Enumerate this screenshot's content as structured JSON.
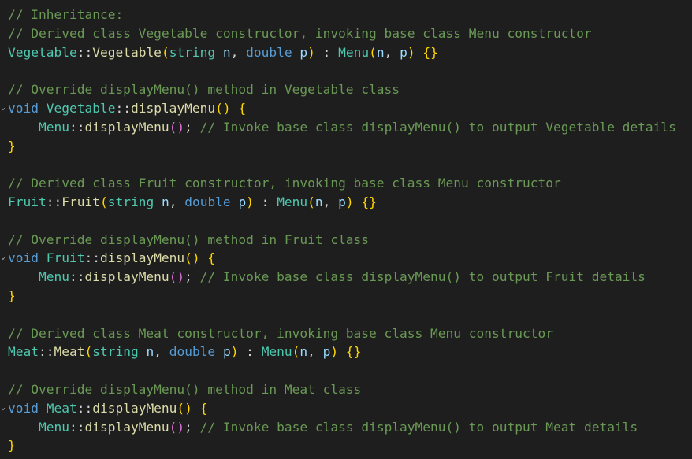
{
  "code": {
    "lines": [
      {
        "tokens": [
          {
            "t": "// Inheritance:",
            "c": "comment"
          }
        ]
      },
      {
        "tokens": [
          {
            "t": "// Derived class Vegetable constructor, invoking base class Menu constructor",
            "c": "comment"
          }
        ]
      },
      {
        "tokens": [
          {
            "t": "Vegetable",
            "c": "type"
          },
          {
            "t": "::",
            "c": "punct"
          },
          {
            "t": "Vegetable",
            "c": "func"
          },
          {
            "t": "(",
            "c": "br1"
          },
          {
            "t": "string",
            "c": "type"
          },
          {
            "t": " ",
            "c": "punct"
          },
          {
            "t": "n",
            "c": "param"
          },
          {
            "t": ", ",
            "c": "punct"
          },
          {
            "t": "double",
            "c": "kw"
          },
          {
            "t": " ",
            "c": "punct"
          },
          {
            "t": "p",
            "c": "param"
          },
          {
            "t": ")",
            "c": "br1"
          },
          {
            "t": " : ",
            "c": "punct"
          },
          {
            "t": "Menu",
            "c": "type"
          },
          {
            "t": "(",
            "c": "br1"
          },
          {
            "t": "n",
            "c": "param"
          },
          {
            "t": ", ",
            "c": "punct"
          },
          {
            "t": "p",
            "c": "param"
          },
          {
            "t": ")",
            "c": "br1"
          },
          {
            "t": " ",
            "c": "punct"
          },
          {
            "t": "{}",
            "c": "br1"
          }
        ]
      },
      {
        "tokens": []
      },
      {
        "tokens": [
          {
            "t": "// Override displayMenu() method in Vegetable class",
            "c": "comment"
          }
        ]
      },
      {
        "fold": true,
        "tokens": [
          {
            "t": "void",
            "c": "kw"
          },
          {
            "t": " ",
            "c": "punct"
          },
          {
            "t": "Vegetable",
            "c": "type"
          },
          {
            "t": "::",
            "c": "punct"
          },
          {
            "t": "displayMenu",
            "c": "func"
          },
          {
            "t": "()",
            "c": "br1"
          },
          {
            "t": " ",
            "c": "punct"
          },
          {
            "t": "{",
            "c": "br1"
          }
        ]
      },
      {
        "tokens": [
          {
            "t": "    ",
            "c": "punct"
          },
          {
            "t": "Menu",
            "c": "type"
          },
          {
            "t": "::",
            "c": "punct"
          },
          {
            "t": "displayMenu",
            "c": "func"
          },
          {
            "t": "()",
            "c": "br2"
          },
          {
            "t": "; ",
            "c": "punct"
          },
          {
            "t": "// Invoke base class displayMenu() to output Vegetable details",
            "c": "comment"
          }
        ]
      },
      {
        "tokens": [
          {
            "t": "}",
            "c": "br1"
          }
        ]
      },
      {
        "tokens": []
      },
      {
        "tokens": [
          {
            "t": "// Derived class Fruit constructor, invoking base class Menu constructor",
            "c": "comment"
          }
        ]
      },
      {
        "tokens": [
          {
            "t": "Fruit",
            "c": "type"
          },
          {
            "t": "::",
            "c": "punct"
          },
          {
            "t": "Fruit",
            "c": "func"
          },
          {
            "t": "(",
            "c": "br1"
          },
          {
            "t": "string",
            "c": "type"
          },
          {
            "t": " ",
            "c": "punct"
          },
          {
            "t": "n",
            "c": "param"
          },
          {
            "t": ", ",
            "c": "punct"
          },
          {
            "t": "double",
            "c": "kw"
          },
          {
            "t": " ",
            "c": "punct"
          },
          {
            "t": "p",
            "c": "param"
          },
          {
            "t": ")",
            "c": "br1"
          },
          {
            "t": " : ",
            "c": "punct"
          },
          {
            "t": "Menu",
            "c": "type"
          },
          {
            "t": "(",
            "c": "br1"
          },
          {
            "t": "n",
            "c": "param"
          },
          {
            "t": ", ",
            "c": "punct"
          },
          {
            "t": "p",
            "c": "param"
          },
          {
            "t": ")",
            "c": "br1"
          },
          {
            "t": " ",
            "c": "punct"
          },
          {
            "t": "{}",
            "c": "br1"
          }
        ]
      },
      {
        "tokens": []
      },
      {
        "tokens": [
          {
            "t": "// Override displayMenu() method in Fruit class",
            "c": "comment"
          }
        ]
      },
      {
        "fold": true,
        "tokens": [
          {
            "t": "void",
            "c": "kw"
          },
          {
            "t": " ",
            "c": "punct"
          },
          {
            "t": "Fruit",
            "c": "type"
          },
          {
            "t": "::",
            "c": "punct"
          },
          {
            "t": "displayMenu",
            "c": "func"
          },
          {
            "t": "()",
            "c": "br1"
          },
          {
            "t": " ",
            "c": "punct"
          },
          {
            "t": "{",
            "c": "br1"
          }
        ]
      },
      {
        "tokens": [
          {
            "t": "    ",
            "c": "punct"
          },
          {
            "t": "Menu",
            "c": "type"
          },
          {
            "t": "::",
            "c": "punct"
          },
          {
            "t": "displayMenu",
            "c": "func"
          },
          {
            "t": "()",
            "c": "br2"
          },
          {
            "t": "; ",
            "c": "punct"
          },
          {
            "t": "// Invoke base class displayMenu() to output Fruit details",
            "c": "comment"
          }
        ]
      },
      {
        "tokens": [
          {
            "t": "}",
            "c": "br1"
          }
        ]
      },
      {
        "tokens": []
      },
      {
        "tokens": [
          {
            "t": "// Derived class Meat constructor, invoking base class Menu constructor",
            "c": "comment"
          }
        ]
      },
      {
        "tokens": [
          {
            "t": "Meat",
            "c": "type"
          },
          {
            "t": "::",
            "c": "punct"
          },
          {
            "t": "Meat",
            "c": "func"
          },
          {
            "t": "(",
            "c": "br1"
          },
          {
            "t": "string",
            "c": "type"
          },
          {
            "t": " ",
            "c": "punct"
          },
          {
            "t": "n",
            "c": "param"
          },
          {
            "t": ", ",
            "c": "punct"
          },
          {
            "t": "double",
            "c": "kw"
          },
          {
            "t": " ",
            "c": "punct"
          },
          {
            "t": "p",
            "c": "param"
          },
          {
            "t": ")",
            "c": "br1"
          },
          {
            "t": " : ",
            "c": "punct"
          },
          {
            "t": "Menu",
            "c": "type"
          },
          {
            "t": "(",
            "c": "br1"
          },
          {
            "t": "n",
            "c": "param"
          },
          {
            "t": ", ",
            "c": "punct"
          },
          {
            "t": "p",
            "c": "param"
          },
          {
            "t": ")",
            "c": "br1"
          },
          {
            "t": " ",
            "c": "punct"
          },
          {
            "t": "{}",
            "c": "br1"
          }
        ]
      },
      {
        "tokens": []
      },
      {
        "tokens": [
          {
            "t": "// Override displayMenu() method in Meat class",
            "c": "comment"
          }
        ]
      },
      {
        "fold": true,
        "tokens": [
          {
            "t": "void",
            "c": "kw"
          },
          {
            "t": " ",
            "c": "punct"
          },
          {
            "t": "Meat",
            "c": "type"
          },
          {
            "t": "::",
            "c": "punct"
          },
          {
            "t": "displayMenu",
            "c": "func"
          },
          {
            "t": "()",
            "c": "br1"
          },
          {
            "t": " ",
            "c": "punct"
          },
          {
            "t": "{",
            "c": "br1"
          }
        ]
      },
      {
        "tokens": [
          {
            "t": "    ",
            "c": "punct"
          },
          {
            "t": "Menu",
            "c": "type"
          },
          {
            "t": "::",
            "c": "punct"
          },
          {
            "t": "displayMenu",
            "c": "func"
          },
          {
            "t": "()",
            "c": "br2"
          },
          {
            "t": "; ",
            "c": "punct"
          },
          {
            "t": "// Invoke base class displayMenu() to output Meat details",
            "c": "comment"
          }
        ]
      },
      {
        "tokens": [
          {
            "t": "}",
            "c": "br1"
          }
        ]
      }
    ]
  },
  "colors": {
    "background": "#1e1e1e",
    "comment": "#6a9955",
    "type": "#4ec9b0",
    "function": "#dcdcaa",
    "keyword": "#569cd6",
    "parameter": "#9cdcfe",
    "bracket_level1": "#ffd700",
    "bracket_level2": "#da70d6"
  },
  "icons": {
    "fold_marker": "chevron-down-icon"
  }
}
